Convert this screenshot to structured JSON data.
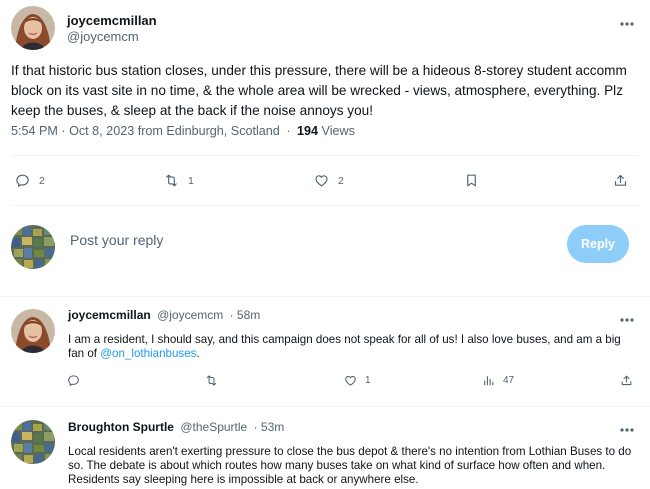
{
  "main_tweet": {
    "display_name": "joycemcmillan",
    "handle": "@joycemcm",
    "text": "If that historic bus station closes, under this pressure, there will be a hideous 8-storey student accomm block on its vast site in no time, & the whole area will be wrecked - views, atmosphere, everything.  Plz keep the buses, & sleep at the back if the noise annoys you!",
    "timestamp": "5:54 PM · Oct 8, 2023 from Edinburgh, Scotland",
    "separator": "·",
    "views_count": "194",
    "views_label": "Views",
    "replies": "2",
    "retweets": "1",
    "likes": "2"
  },
  "composer": {
    "placeholder": "Post your reply",
    "button_label": "Reply"
  },
  "replies": [
    {
      "display_name": "joycemcmillan",
      "handle": "@joycemcm",
      "time": "· 58m",
      "text": "I am a resident, I should say, and this campaign does not speak for all of us!  I also love buses, and am a big fan of",
      "mention": "@on_lothianbuses",
      "text_end": ".",
      "likes": "1",
      "views": "47"
    },
    {
      "display_name": "Broughton Spurtle",
      "handle": "@theSpurtle",
      "time": "· 53m",
      "text": "Local residents aren't exerting pressure to close the bus depot & there's no intention from Lothian Buses to do so. The debate is about which routes how many buses take on what kind of surface how often and when. Residents say sleeping here is impossible at back or anywhere else."
    }
  ],
  "colors": {
    "accent": "#1d9bf0",
    "reply_button_disabled": "#8ecdf8",
    "muted_text": "#536471"
  }
}
